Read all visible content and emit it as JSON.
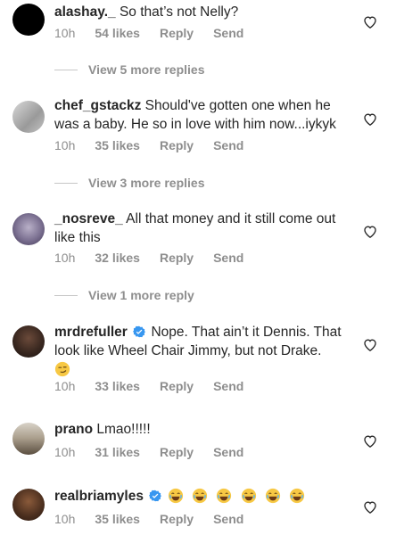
{
  "comments": [
    {
      "username": "alashay._",
      "text": "So that’s not Nelly?",
      "time": "10h",
      "likes": "54 likes",
      "reply": "Reply",
      "send": "Send",
      "view_replies": "View 5 more replies"
    },
    {
      "username": "chef_gstackz",
      "text": "Should've gotten one when he was a baby. He so in love with him now...iykyk",
      "time": "10h",
      "likes": "35 likes",
      "reply": "Reply",
      "send": "Send",
      "view_replies": "View 3 more replies"
    },
    {
      "username": "_nosreve_",
      "text": "All that money and it still come out like this",
      "time": "10h",
      "likes": "32 likes",
      "reply": "Reply",
      "send": "Send",
      "view_replies": "View 1 more reply"
    },
    {
      "username": "mrdrefuller",
      "text": "Nope. That ain’t it Dennis. That look like Wheel Chair Jimmy, but not Drake.",
      "time": "10h",
      "likes": "33 likes",
      "reply": "Reply",
      "send": "Send"
    },
    {
      "username": "prano",
      "text": "Lmao!!!!!",
      "time": "10h",
      "likes": "31 likes",
      "reply": "Reply",
      "send": "Send"
    },
    {
      "username": "realbriamyles",
      "text": "",
      "time": "10h",
      "likes": "35 likes",
      "reply": "Reply",
      "send": "Send"
    }
  ],
  "icons": {
    "heart": "heart-outline-icon",
    "verified": "verified-badge-icon",
    "emoji_smirk": "smirking-face-emoji",
    "emoji_laugh": "rolling-laughing-emoji"
  },
  "colors": {
    "verified": "#3897f0",
    "muted": "#8e8e8e",
    "text": "#262626"
  }
}
